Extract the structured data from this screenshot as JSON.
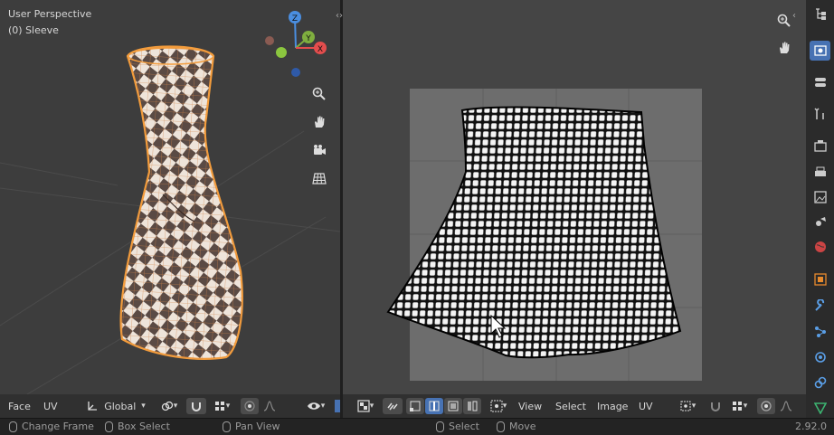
{
  "viewport3d": {
    "title": "User Perspective",
    "object_label": "(0) Sleeve",
    "gizmo": {
      "z": "Z",
      "y": "Y",
      "x": "X"
    },
    "icons": [
      "zoom-icon",
      "hand-pan-icon",
      "camera-icon",
      "grid-icon"
    ],
    "header": {
      "mode": "Face",
      "uv_menu": "UV",
      "orientation": "Global"
    }
  },
  "uv_editor": {
    "header": {
      "view": "View",
      "select": "Select",
      "image": "Image",
      "uv": "UV"
    },
    "icons": [
      "zoom-icon",
      "hand-pan-icon"
    ]
  },
  "statusbar": {
    "left1": "Change Frame",
    "left2": "Box Select",
    "left3": "Pan View",
    "right1": "Select",
    "right2": "Move",
    "version": "2.92.0"
  },
  "colors": {
    "accent": "#4772b3",
    "selection_orange": "#f39c3c",
    "axis_x": "#e44d4d",
    "axis_y": "#7fae3f",
    "axis_z": "#4a8ee0"
  }
}
